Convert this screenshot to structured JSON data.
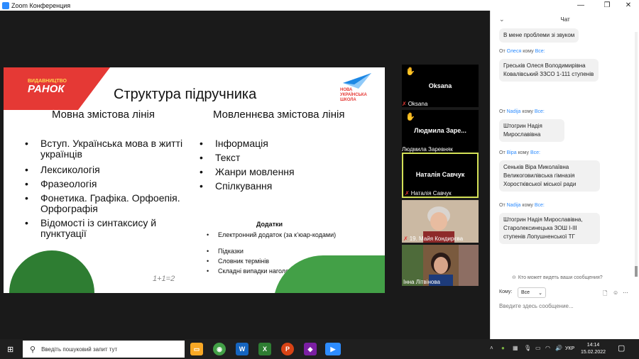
{
  "window": {
    "title": "Zoom Конференция",
    "chat_minimize": "—",
    "chat_maximize": "❐",
    "close": "✕"
  },
  "slide": {
    "publisher_small": "ВИДАВНИЦТВО",
    "publisher_big": "РАНОК",
    "nus_logo": "НОВА УКРАЇНСЬКА ШКОЛА",
    "title": "Структура підручника",
    "col1_head": "Мовна змістова лінія",
    "col1_items": [
      "Вступ. Українська мова в житті українців",
      "Лексикологія",
      "Фразеологія",
      "Фонетика. Графіка. Орфоепія. Орфографія",
      "Відомості із синтаксису й пунктуації"
    ],
    "col2_head": "Мовленнєва змістова лінія",
    "col2_items": [
      "Інформація",
      "Текст",
      "Жанри мовлення",
      "Спілкування"
    ],
    "additions_head": "Додатки",
    "additions": [
      "Електронний додаток (за к’юар-кодами)",
      "Підказки",
      "Словник термінів",
      "Складні випадки наголошування"
    ],
    "math": "1+1=2"
  },
  "participants": [
    {
      "big": "Oksana",
      "name": "Oksana",
      "hand": true,
      "highlight": false
    },
    {
      "big": "Людмила  Заре...",
      "name": "Людмила Заревняк",
      "hand": true,
      "highlight": false
    },
    {
      "big": "Наталія Савчук",
      "name": "Наталія Савчук",
      "hand": false,
      "highlight": true
    },
    {
      "big": "",
      "name": "19. Майя Кондирєва",
      "hand": false,
      "highlight": false
    },
    {
      "big": "",
      "name": "Інна Літвінова",
      "hand": false,
      "highlight": false
    }
  ],
  "chat": {
    "header": "Чат",
    "top_msg": "В мене проблеми зі звуком",
    "messages": [
      {
        "from_label": "От",
        "sender": "Олеся",
        "to_label": "кому",
        "to": "Все:",
        "text": "Греськів Олеся Володимирівна Ковалівський ЗЗСО 1-111 ступенів"
      },
      {
        "from_label": "От",
        "sender": "Nadija",
        "to_label": "кому",
        "to": "Все:",
        "text": "Штогрин Надія Мирославівна"
      },
      {
        "from_label": "От",
        "sender": "Віра",
        "to_label": "кому",
        "to": "Все:",
        "text": "Сеньків Віра Миколаївна Великоговилівська гімназія Хоростківської міської ради"
      },
      {
        "from_label": "От",
        "sender": "Nadija",
        "to_label": "кому",
        "to": "Все:",
        "text": "Штогрин Надія Мирославівна, Старолексинецька ЗОШ І-ІІІ ступенів Лопушненської ТГ"
      }
    ],
    "who_can_see": "Кто может видеть ваши сообщения?",
    "to_label": "Кому:",
    "to_value": "Все",
    "placeholder": "Введите здесь сообщение..."
  },
  "taskbar": {
    "search_placeholder": "Введіть пошуковий запит тут",
    "lang": "УКР",
    "time": "14:14",
    "date": "15.02.2022"
  }
}
